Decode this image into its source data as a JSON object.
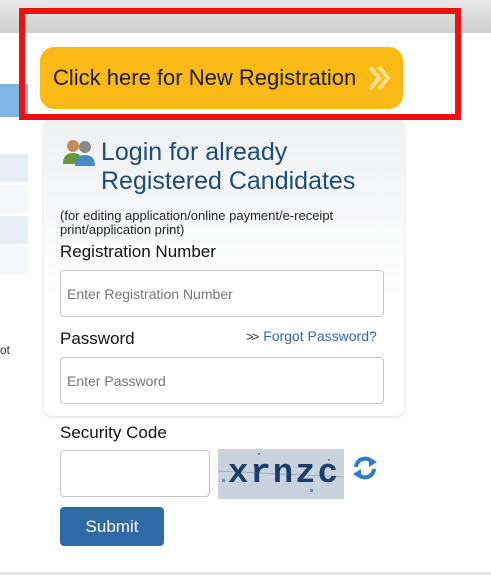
{
  "new_registration": {
    "label": "Click here for New Registration"
  },
  "login": {
    "title": "Login for already Registered Candidates",
    "hint": "(for editing application/online payment/e-receipt print/application print)"
  },
  "fields": {
    "registration_label": "Registration Number",
    "registration_placeholder": "Enter Registration Number",
    "registration_value": "",
    "password_label": "Password",
    "password_placeholder": "Enter Password",
    "password_value": "",
    "security_label": "Security Code",
    "security_value": ""
  },
  "forgot_password": "Forgot Password?",
  "captcha_text": "xrnzc",
  "submit_label": "Submit",
  "stray_text": "ot",
  "colors": {
    "accent_orange": "#fbb916",
    "highlight_red": "#ee1111",
    "title_blue": "#1c4d7a",
    "button_blue": "#2f6aa6",
    "link_blue": "#2e6ba8"
  },
  "icons": [
    "users-icon",
    "double-chevron-right-icon",
    "refresh-icon"
  ]
}
